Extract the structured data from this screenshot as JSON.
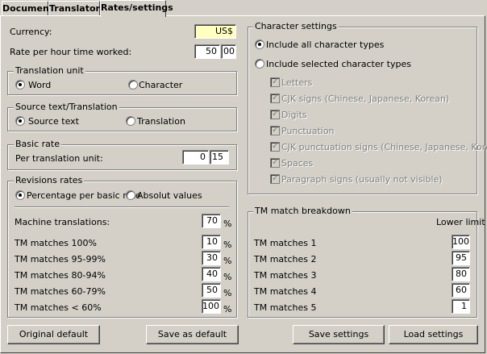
{
  "tabs": [
    "Document",
    "Translators",
    "Rates/settings"
  ],
  "currency": {
    "label": "Currency:",
    "value": "US$"
  },
  "rate_hour": {
    "label": "Rate per hour time worked:",
    "main": "50",
    "cents": "00"
  },
  "translation_unit": {
    "title": "Translation unit",
    "opt1": "Word",
    "opt2": "Character"
  },
  "source_translation": {
    "title": "Source text/Translation",
    "opt1": "Source text",
    "opt2": "Translation"
  },
  "basic_rate": {
    "title": "Basic rate",
    "label": "Per translation unit:",
    "main": "0",
    "cents": "15"
  },
  "revisions": {
    "title": "Revisions rates",
    "opt1": "Percentage per basic rate",
    "opt2": "Absolut values",
    "rows": [
      {
        "label": "Machine translations:",
        "value": "70"
      },
      {
        "label": "TM matches 100%",
        "value": "10"
      },
      {
        "label": "TM matches 95-99%",
        "value": "30"
      },
      {
        "label": "TM matches 80-94%",
        "value": "40"
      },
      {
        "label": "TM matches 60-79%",
        "value": "50"
      },
      {
        "label": "TM matches < 60%",
        "value": "100"
      }
    ],
    "unit": "%"
  },
  "char_settings": {
    "title": "Character settings",
    "opt1": "Include all character types",
    "opt2": "Include selected character types",
    "items": [
      "Letters",
      "CJK signs (Chinese, Japanese, Korean)",
      "Digits",
      "Punctuation",
      "CJK punctuation signs (Chinese, Japanese, Korean)",
      "Spaces",
      "Paragraph signs (usually not visible)"
    ]
  },
  "tm_breakdown": {
    "title": "TM match breakdown",
    "header": "Lower limit",
    "rows": [
      {
        "label": "TM matches 1",
        "value": "100"
      },
      {
        "label": "TM matches 2",
        "value": "95"
      },
      {
        "label": "TM matches 3",
        "value": "80"
      },
      {
        "label": "TM matches 4",
        "value": "60"
      },
      {
        "label": "TM matches 5",
        "value": "1"
      }
    ]
  },
  "buttons": {
    "original": "Original default",
    "save_default": "Save as default",
    "save": "Save settings",
    "load": "Load settings"
  }
}
